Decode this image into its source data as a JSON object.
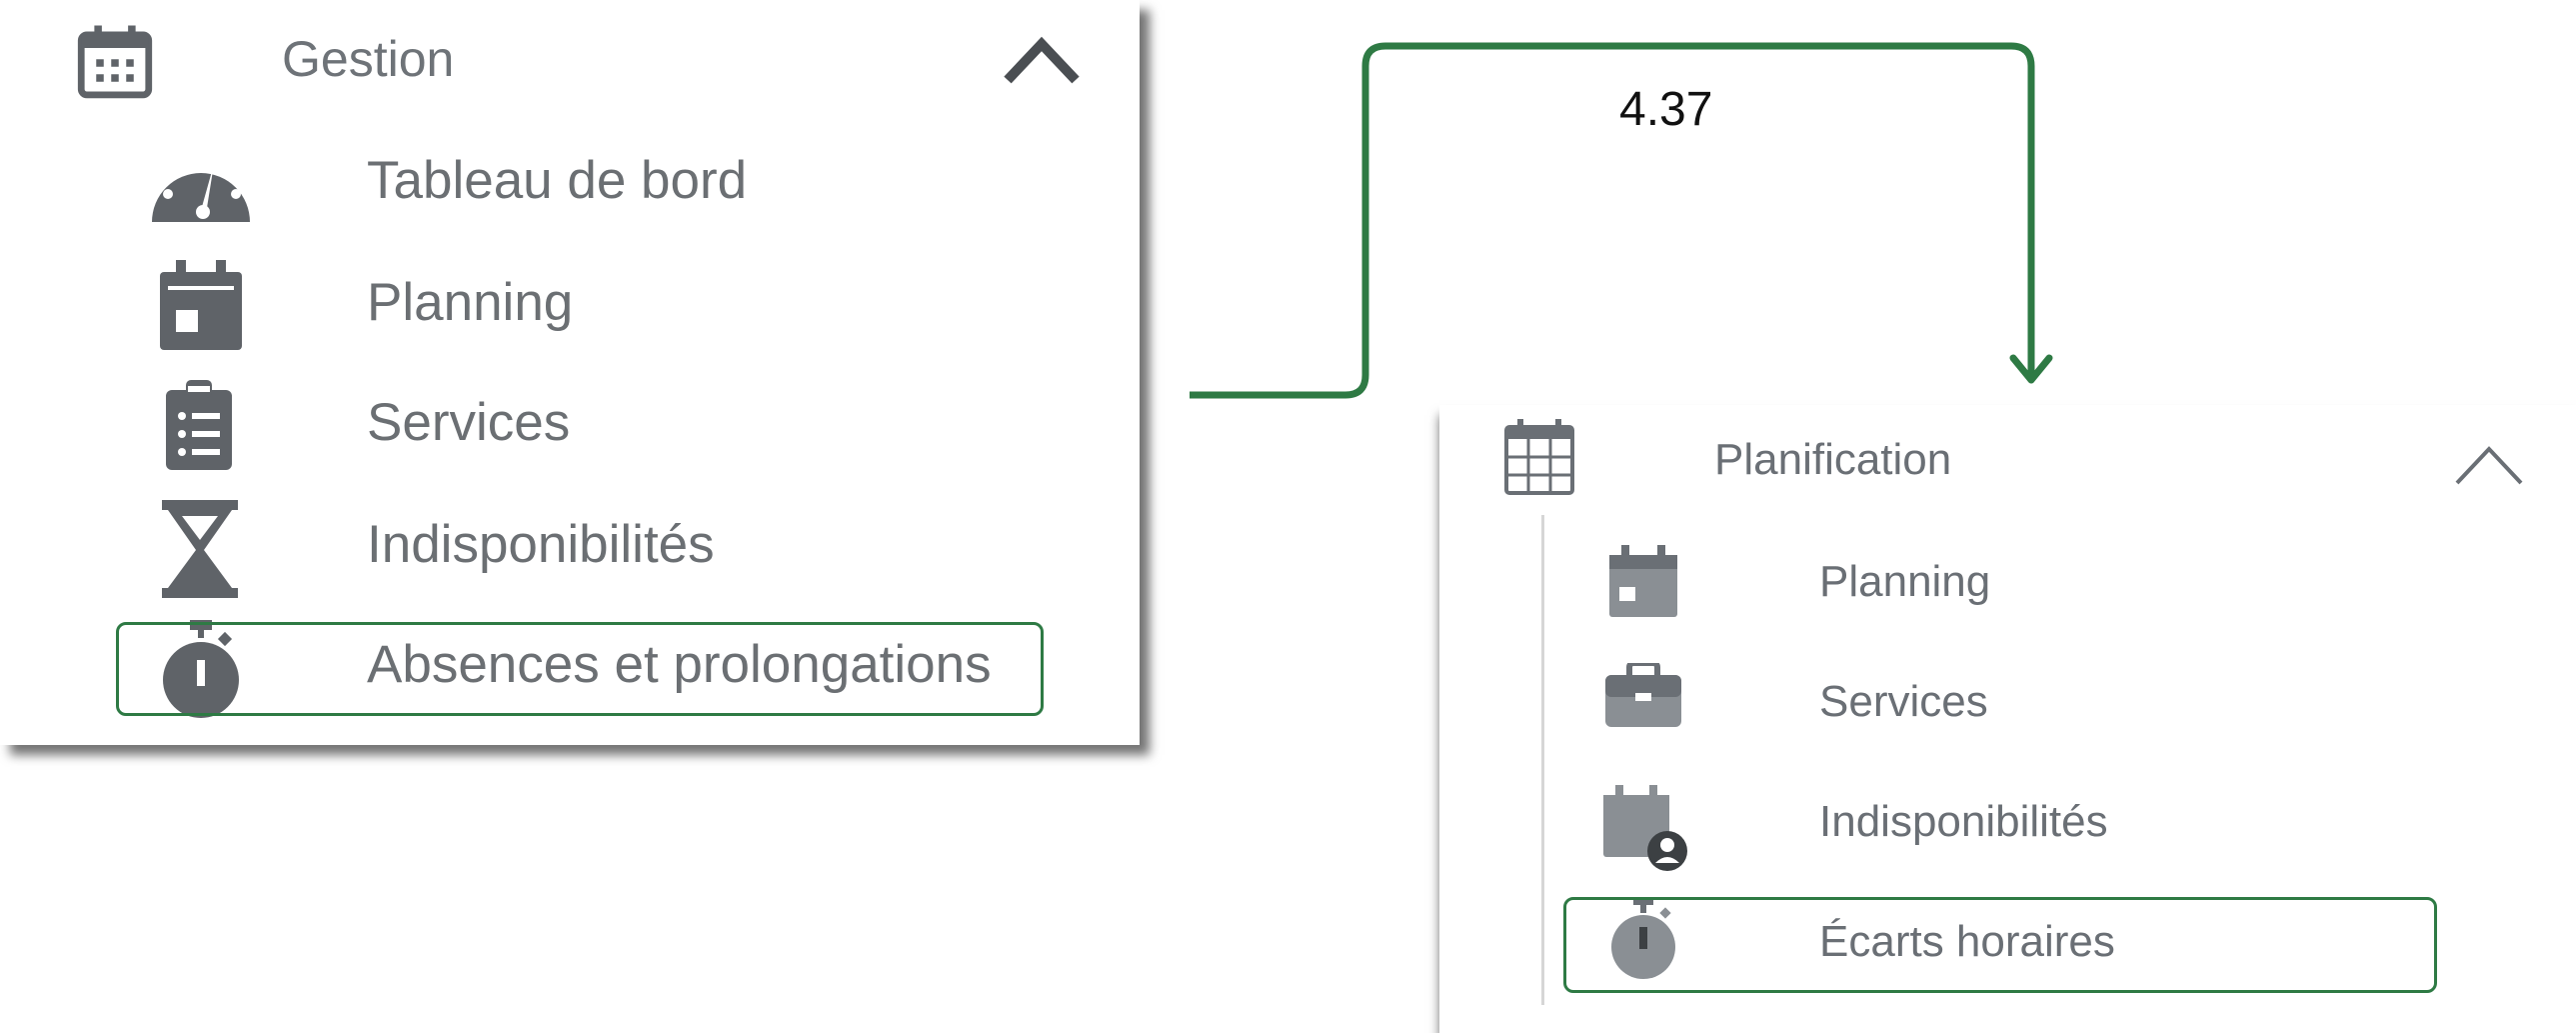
{
  "step_label": "4.37",
  "colors": {
    "highlight": "#2e7a44",
    "connector": "#2e7a44",
    "icon_dark": "#5f6368",
    "icon_light": "#8a8f94"
  },
  "left_menu": {
    "header": {
      "label": "Gestion",
      "icon": "calendar-icon",
      "expand_icon": "chevron-up-icon"
    },
    "items": [
      {
        "label": "Tableau de bord",
        "icon": "speedometer-icon"
      },
      {
        "label": "Planning",
        "icon": "calendar-icon"
      },
      {
        "label": "Services",
        "icon": "clipboard-list-icon"
      },
      {
        "label": "Indisponibilités",
        "icon": "hourglass-icon"
      },
      {
        "label": "Absences et prolongations",
        "icon": "stopwatch-icon",
        "highlighted": true
      }
    ]
  },
  "right_menu": {
    "header": {
      "label": "Planification",
      "icon": "calendar-grid-icon",
      "expand_icon": "chevron-up-icon"
    },
    "items": [
      {
        "label": "Planning",
        "icon": "calendar-icon"
      },
      {
        "label": "Services",
        "icon": "briefcase-icon"
      },
      {
        "label": "Indisponibilités",
        "icon": "calendar-user-icon"
      },
      {
        "label": "Écarts horaires",
        "icon": "stopwatch-icon",
        "highlighted": true
      }
    ]
  }
}
